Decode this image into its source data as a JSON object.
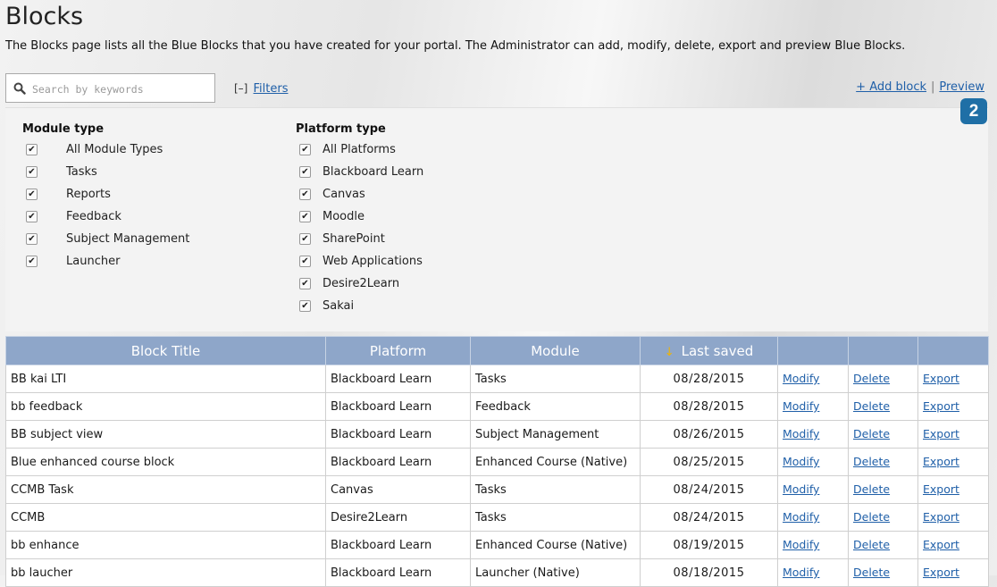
{
  "page": {
    "title": "Blocks",
    "description": "The Blocks page lists all the Blue Blocks that you have created for your portal. The Administrator can add, modify, delete, export and preview Blue Blocks."
  },
  "search": {
    "placeholder": "Search by keywords",
    "value": ""
  },
  "filters_toggle": {
    "mark": "[–]",
    "label": "Filters"
  },
  "actions": {
    "add_block": "+ Add block",
    "separator": "|",
    "preview": "Preview"
  },
  "step_badge": "2",
  "filters": {
    "module_type": {
      "title": "Module type",
      "options": [
        {
          "label": "All Module Types",
          "checked": true
        },
        {
          "label": "Tasks",
          "checked": true
        },
        {
          "label": "Reports",
          "checked": true
        },
        {
          "label": "Feedback",
          "checked": true
        },
        {
          "label": "Subject Management",
          "checked": true
        },
        {
          "label": "Launcher",
          "checked": true
        }
      ]
    },
    "platform_type": {
      "title": "Platform type",
      "options": [
        {
          "label": "All Platforms",
          "checked": true
        },
        {
          "label": "Blackboard Learn",
          "checked": true
        },
        {
          "label": "Canvas",
          "checked": true
        },
        {
          "label": "Moodle",
          "checked": true
        },
        {
          "label": "SharePoint",
          "checked": true
        },
        {
          "label": "Web Applications",
          "checked": true
        },
        {
          "label": "Desire2Learn",
          "checked": true
        },
        {
          "label": "Sakai",
          "checked": true
        }
      ]
    }
  },
  "table": {
    "headers": {
      "title": "Block Title",
      "platform": "Platform",
      "module": "Module",
      "last_saved": "Last saved",
      "sort_arrow": "↓"
    },
    "action_labels": {
      "modify": "Modify",
      "delete": "Delete",
      "export": "Export"
    },
    "rows": [
      {
        "title": "BB kai LTI",
        "platform": "Blackboard Learn",
        "module": "Tasks",
        "date": "08/28/2015"
      },
      {
        "title": "bb feedback",
        "platform": "Blackboard Learn",
        "module": "Feedback",
        "date": "08/28/2015"
      },
      {
        "title": "BB subject view",
        "platform": "Blackboard Learn",
        "module": "Subject Management",
        "date": "08/26/2015"
      },
      {
        "title": "Blue enhanced course block",
        "platform": "Blackboard Learn",
        "module": "Enhanced Course (Native)",
        "date": "08/25/2015"
      },
      {
        "title": "CCMB Task",
        "platform": "Canvas",
        "module": "Tasks",
        "date": "08/24/2015"
      },
      {
        "title": "CCMB",
        "platform": "Desire2Learn",
        "module": "Tasks",
        "date": "08/24/2015"
      },
      {
        "title": "bb enhance",
        "platform": "Blackboard Learn",
        "module": "Enhanced Course (Native)",
        "date": "08/19/2015"
      },
      {
        "title": "bb laucher",
        "platform": "Blackboard Learn",
        "module": "Launcher (Native)",
        "date": "08/18/2015"
      }
    ]
  }
}
